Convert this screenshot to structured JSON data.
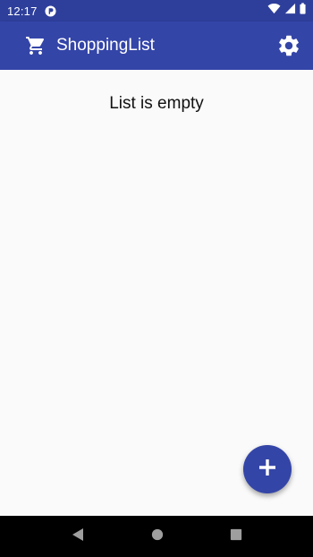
{
  "status_bar": {
    "time": "12:17",
    "icons": [
      "notification-icon",
      "wifi-icon",
      "signal-icon",
      "battery-icon"
    ]
  },
  "toolbar": {
    "title": "ShoppingList",
    "icons": [
      "cart-icon",
      "settings-icon"
    ]
  },
  "main": {
    "empty_message": "List is empty"
  },
  "fab": {
    "icon": "plus-icon"
  },
  "nav_bar": {
    "icons": [
      "back-icon",
      "home-icon",
      "recents-icon"
    ]
  },
  "colors": {
    "primary": "#3445a8",
    "primary_dark": "#2e3f9b",
    "background": "#fafafa"
  }
}
